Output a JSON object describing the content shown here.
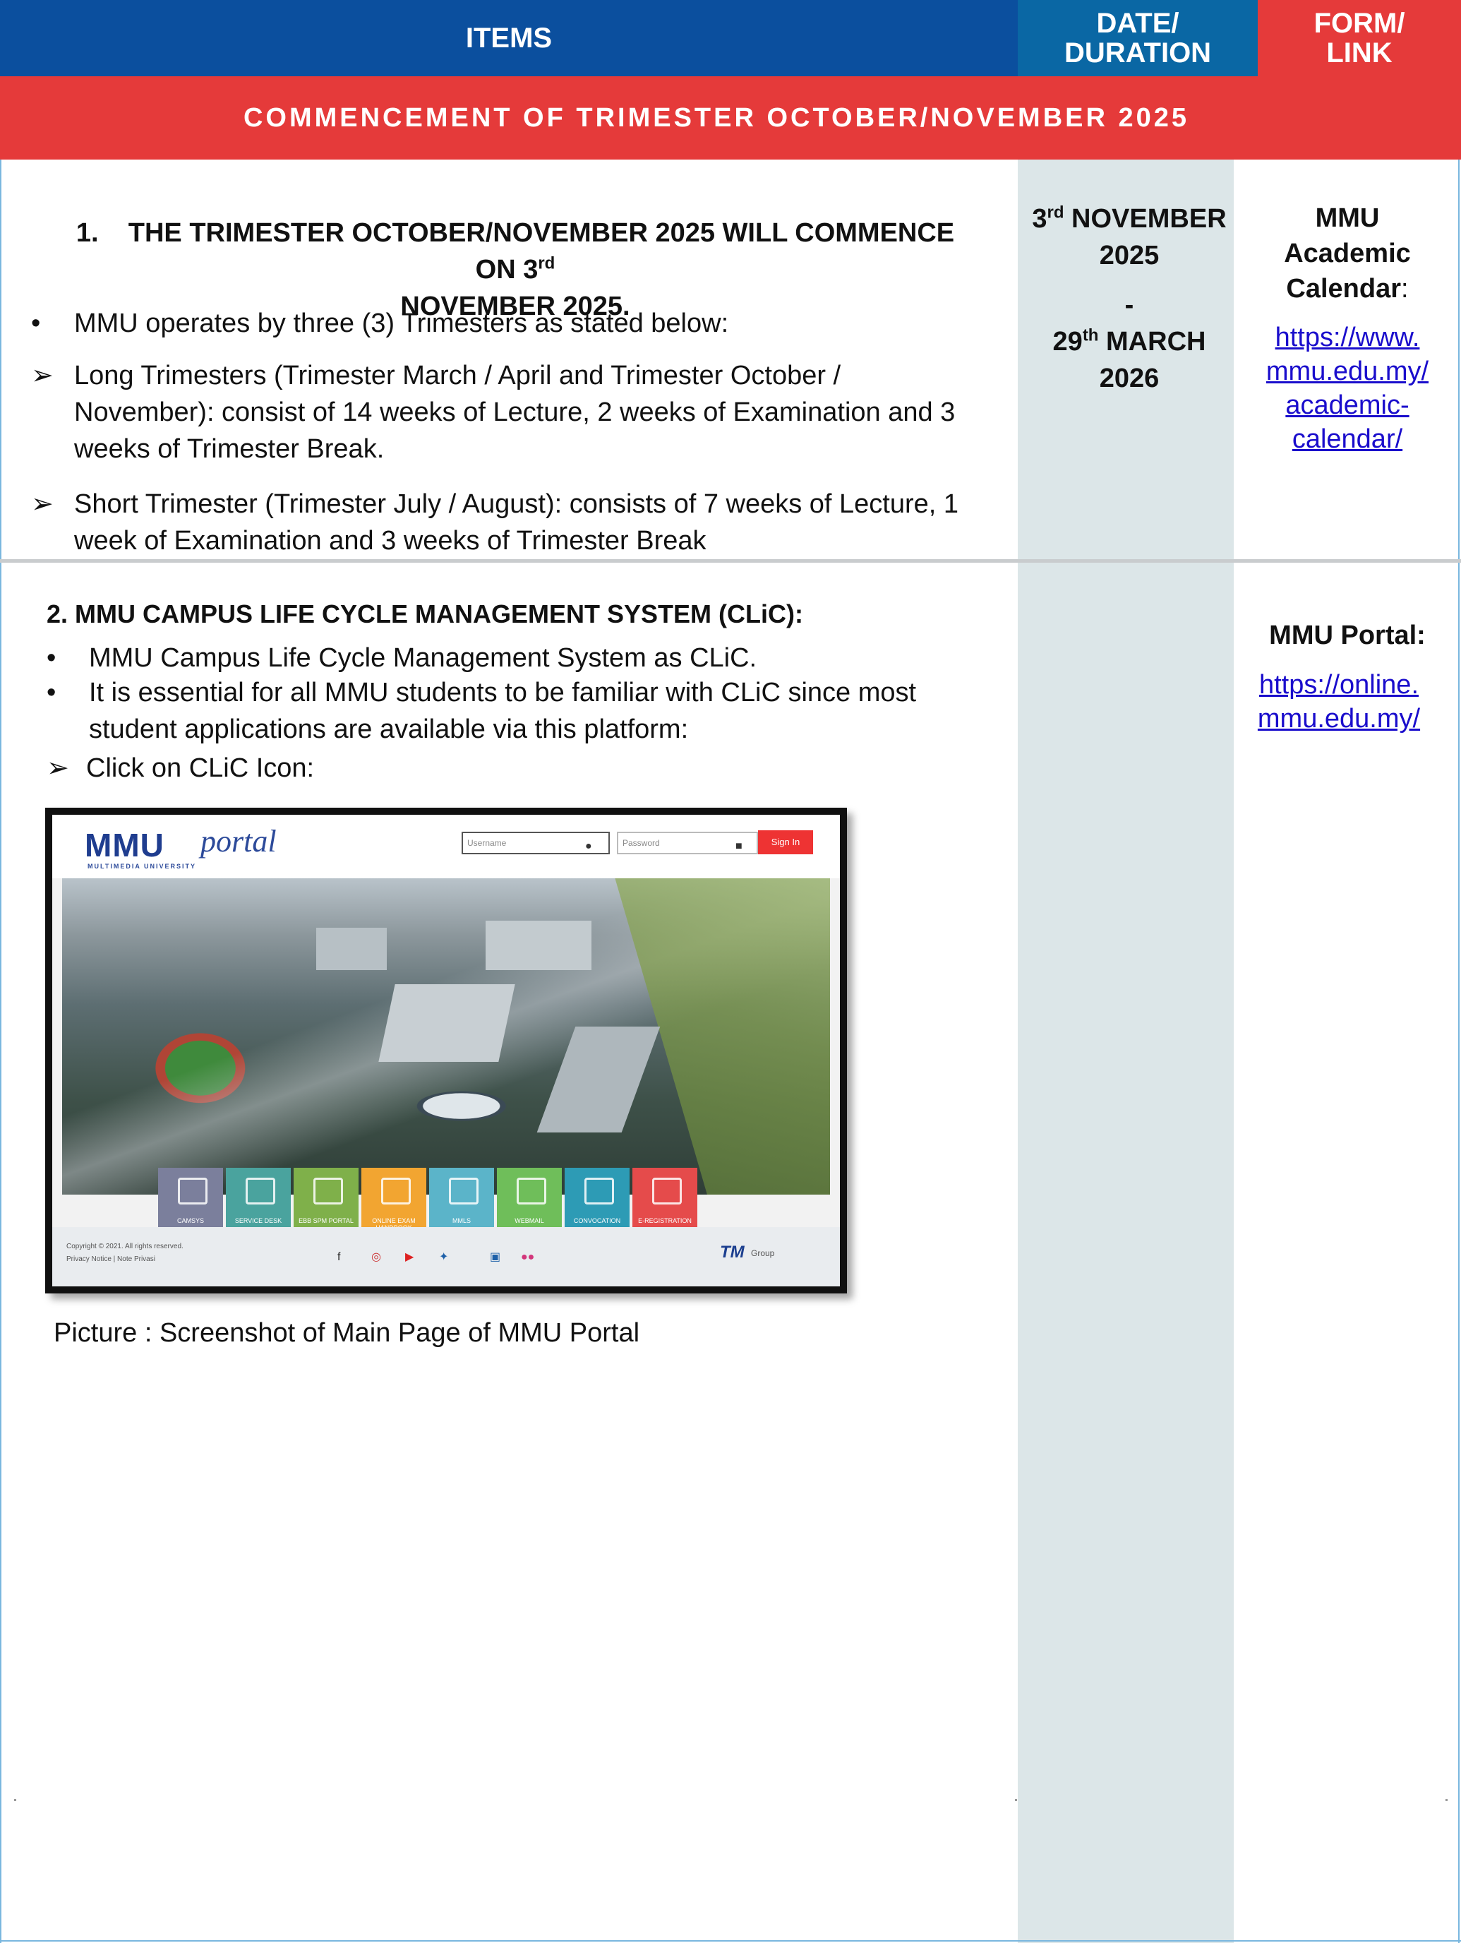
{
  "header": {
    "items": "ITEMS",
    "date_line1": "DATE/",
    "date_line2": "DURATION",
    "form_line1": "FORM/",
    "form_line2": "LINK"
  },
  "banner": "COMMENCEMENT OF TRIMESTER OCTOBER/NOVEMBER 2025",
  "section1": {
    "heading_num": "1.",
    "heading_a": "THE TRIMESTER  OCTOBER/NOVEMBER 2025 WILL COMMENCE ON 3",
    "heading_sup": "rd",
    "heading_b": "NOVEMBER  2025.",
    "bullet": "MMU operates by three (3) Trimesters as stated below:",
    "arrow1": "Long Trimesters (Trimester March / April and Trimester October / November): consist of 14 weeks of Lecture, 2 weeks of Examination and 3 weeks of Trimester Break.",
    "arrow2": "Short Trimester (Trimester July / August): consists of 7 weeks of Lecture, 1 week of Examination and 3 weeks of Trimester Break",
    "date_start_day": "3",
    "date_start_sup": "rd",
    "date_start_rest": " NOVEMBER",
    "date_start_year": "2025",
    "date_dash": "-",
    "date_end_day": "29",
    "date_end_sup": "th",
    "date_end_rest": " MARCH",
    "date_end_year": "2026",
    "form_label_1": "MMU",
    "form_label_2": "Academic",
    "form_label_3": "Calendar",
    "form_label_colon": ":",
    "link_lines": [
      "https://www.",
      "mmu.edu.my/",
      "academic-",
      "calendar/"
    ]
  },
  "section2": {
    "heading": "2. MMU CAMPUS LIFE CYCLE MANAGEMENT SYSTEM (CLiC):",
    "bullet1": "MMU Campus Life Cycle Management System as CLiC.",
    "bullet2_a": "It is essential for all MMU students to be familiar with CLiC since most",
    "bullet2_b": "student applications are available via this platform:",
    "arrow": "Click on CLiC Icon:",
    "caption": "Picture : Screenshot of Main Page of MMU Portal",
    "form_label": "MMU Portal:",
    "link_lines": [
      "https://online.",
      "mmu.edu.my/"
    ]
  },
  "portal": {
    "logo": "MMU",
    "logo_script": "portal",
    "logo_sub": "MULTIMEDIA UNIVERSITY",
    "username_ph": "Username",
    "password_ph": "Password",
    "signin": "Sign In",
    "tiles": [
      {
        "label": "CAMSYS",
        "color": "#7b7f9c"
      },
      {
        "label": "SERVICE DESK",
        "color": "#4aa39e"
      },
      {
        "label": "EBB SPM PORTAL",
        "color": "#7fb04a"
      },
      {
        "label": "ONLINE EXAM HANDBOOK",
        "color": "#f2a531"
      },
      {
        "label": "MMLS",
        "color": "#5bb4c9"
      },
      {
        "label": "WEBMAIL",
        "color": "#6fbe5a"
      },
      {
        "label": "CONVOCATION",
        "color": "#2d9bb5"
      },
      {
        "label": "E-REGISTRATION",
        "color": "#e54b4b"
      }
    ],
    "footer_copy": "Copyright © 2021. All rights reserved.",
    "footer_links": "Privacy Notice | Note Privasi",
    "tm_logo": "TM",
    "tm_group": "Group"
  }
}
